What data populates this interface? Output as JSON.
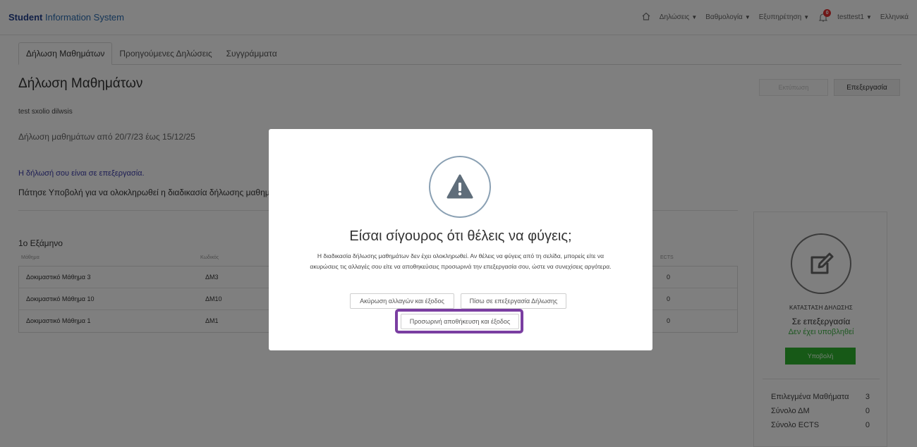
{
  "header": {
    "brand_strong": "Student",
    "brand_rest": " Information System",
    "nav": [
      {
        "label": "Δηλώσεις"
      },
      {
        "label": "Βαθμολογία"
      },
      {
        "label": "Εξυπηρέτηση"
      }
    ],
    "notifications_count": "0",
    "user": "testtest1",
    "language": "Ελληνικά"
  },
  "tabs": [
    {
      "label": "Δήλωση Μαθημάτων",
      "active": true
    },
    {
      "label": "Προηγούμενες Δηλώσεις"
    },
    {
      "label": "Συγγράμματα"
    }
  ],
  "page": {
    "title": "Δήλωση Μαθημάτων",
    "print_label": "Εκτύπωση",
    "edit_label": "Επεξεργασία",
    "subtitle": "test sxolio dilwsis",
    "period": "Δήλωση μαθημάτων από 20/7/23 έως 15/12/25",
    "status_text": "Η δήλωσή σου είναι σε επεξεργασία.",
    "hint": "Πάτησε Υποβολή για να ολοκληρωθεί η διαδικασία δήλωσης μαθημ"
  },
  "semester": {
    "title": "1ο Εξάμηνο",
    "columns": [
      "Μάθημα",
      "Κωδικός",
      "ECTS"
    ],
    "rows": [
      {
        "course": "Δοκιμαστικό Μάθημα 3",
        "code": "ΔΜ3",
        "ects": "0"
      },
      {
        "course": "Δοκιμαστικό Μάθημα 10",
        "code": "ΔΜ10",
        "ects": "0"
      },
      {
        "course": "Δοκιμαστικό Μάθημα 1",
        "code": "ΔΜ1",
        "ects": "0"
      }
    ]
  },
  "status_panel": {
    "label": "ΚΑΤΑΣΤΑΣΗ ΔΗΛΩΣΗΣ",
    "state": "Σε επεξεργασία",
    "sub": "Δεν έχει υποβληθεί",
    "submit_label": "Υποβολή",
    "stats": [
      {
        "label": "Επιλεγμένα Μαθήματα",
        "value": "3"
      },
      {
        "label": "Σύνολο ΔΜ",
        "value": "0"
      },
      {
        "label": "Σύνολο ECTS",
        "value": "0"
      }
    ]
  },
  "modal": {
    "title": "Είσαι σίγουρος ότι θέλεις να φύγεις;",
    "text_line1": "Η διαδικασία δήλωσης μαθημάτων δεν έχει ολοκληρωθεί. Αν θέλεις να φύγεις από τη σελίδα, μπορείς είτε να",
    "text_line2": "ακυρώσεις τις αλλαγές σου είτε να αποθηκεύσεις προσωρινά την επεξεργασία σου, ώστε να συνεχίσεις αργότερα.",
    "cancel_label": "Ακύρωση αλλαγών και έξοδος",
    "back_label": "Πίσω σε επεξεργασία Δήλωσης",
    "save_label": "Προσωρινή αποθήκευση και έξοδος"
  },
  "colors": {
    "brand": "#23408e",
    "highlight": "#7a3ea1",
    "submit": "#2fb32f",
    "status_link": "#3b3ba8"
  }
}
